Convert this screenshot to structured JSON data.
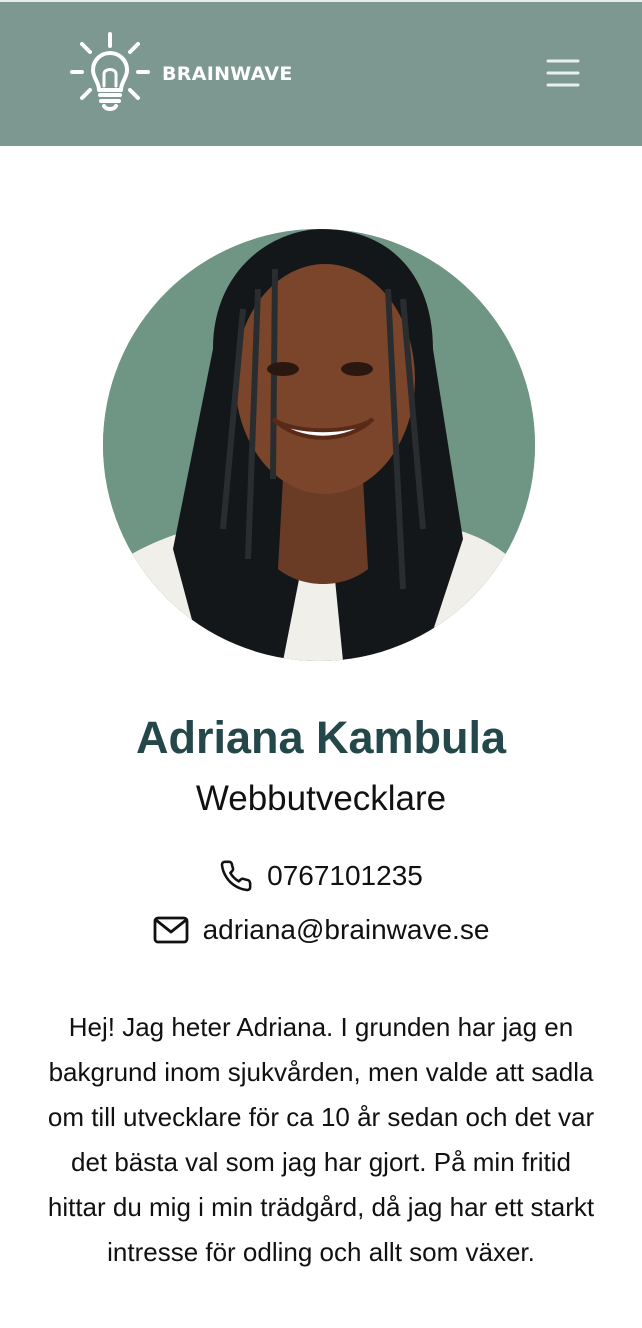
{
  "header": {
    "brand_name": "BRAINWAVE",
    "logo_icon": "lightbulb-icon",
    "menu_icon": "hamburger-menu-icon",
    "background_color": "#7d9890"
  },
  "profile": {
    "photo_alt": "Adriana Kambula",
    "name": "Adriana Kambula",
    "role": "Webbutvecklare",
    "name_color": "#24474a"
  },
  "contact": {
    "phone_icon": "phone-icon",
    "phone": "0767101235",
    "email_icon": "envelope-icon",
    "email": "adriana@brainwave.se"
  },
  "bio": {
    "text": "Hej! Jag heter Adriana. I grunden har jag en bakgrund inom sjukvården, men valde att sadla om till utvecklare för ca 10 år sedan och det var det bästa val som jag har gjort. På min fritid hittar du mig i min trädgård, då jag har ett starkt intresse för odling och allt som växer."
  }
}
